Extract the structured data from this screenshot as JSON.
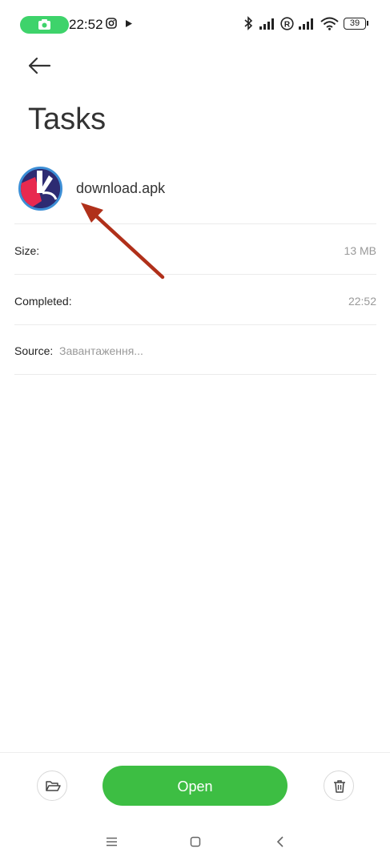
{
  "status_bar": {
    "time": "22:52",
    "battery": "39",
    "accent_color": "#3ed36b"
  },
  "header": {
    "back_icon": "arrow-left-icon",
    "title": "Tasks"
  },
  "file": {
    "name": "download.apk",
    "icon": "app-icon"
  },
  "details": {
    "size_label": "Size:",
    "size_value": "13 MB",
    "completed_label": "Completed:",
    "completed_value": "22:52",
    "source_label": "Source:",
    "source_value": "Завантаження..."
  },
  "actions": {
    "folder_icon": "folder-open-icon",
    "open_label": "Open",
    "open_color": "#3dbe43",
    "delete_icon": "trash-icon"
  },
  "nav": {
    "menu_icon": "menu-icon",
    "home_icon": "home-square-icon",
    "back_icon": "chevron-left-icon"
  },
  "annotation": {
    "arrow_color": "#b0301a"
  }
}
